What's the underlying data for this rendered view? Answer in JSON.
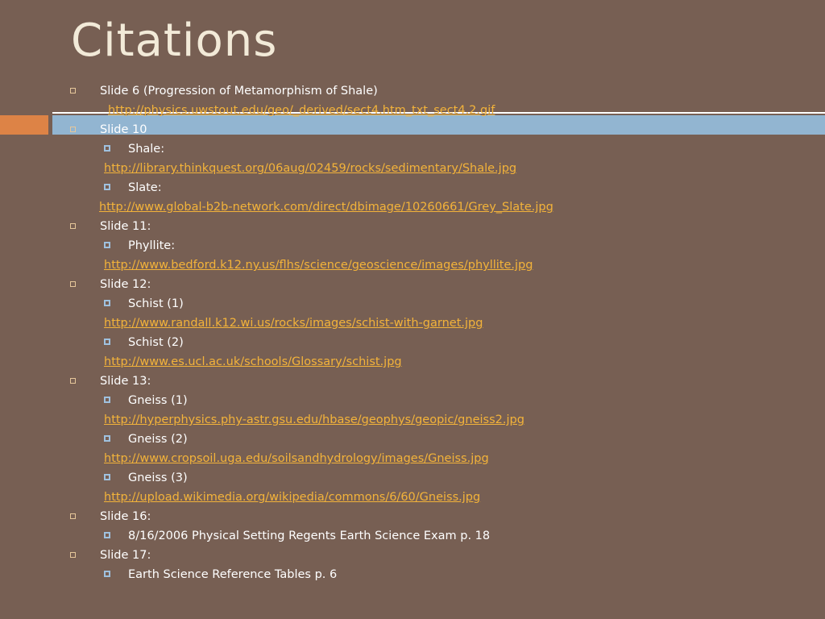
{
  "slide": {
    "title": "Citations",
    "colors": {
      "background": "#775f53",
      "title": "#f2ead8",
      "link": "#f3b33a",
      "accent_orange": "#dd8346",
      "accent_blue": "#92b5d1"
    },
    "items": [
      {
        "level": 1,
        "text": "Slide 6 (Progression of Metamorphism of Shale)"
      },
      {
        "level": "link",
        "text": "http://physics.uwstout.edu/geo/_derived/sect4.htm_txt_sect4.2.gif"
      },
      {
        "level": 1,
        "text": "Slide 10"
      },
      {
        "level": 2,
        "text": "Shale:"
      },
      {
        "level": "link",
        "text": "http://library.thinkquest.org/06aug/02459/rocks/sedimentary/Shale.jpg"
      },
      {
        "level": 2,
        "text": "Slate:"
      },
      {
        "level": "link",
        "text": "http://www.global-b2b-network.com/direct/dbimage/10260661/Grey_Slate.jpg"
      },
      {
        "level": 1,
        "text": "Slide 11:"
      },
      {
        "level": 2,
        "text": "Phyllite:"
      },
      {
        "level": "link",
        "text": "http://www.bedford.k12.ny.us/flhs/science/geoscience/images/phyllite.jpg"
      },
      {
        "level": 1,
        "text": "Slide 12:"
      },
      {
        "level": 2,
        "text": "Schist (1)"
      },
      {
        "level": "link",
        "text": "http://www.randall.k12.wi.us/rocks/images/schist-with-garnet.jpg"
      },
      {
        "level": 2,
        "text": "Schist (2)"
      },
      {
        "level": "link",
        "text": "http://www.es.ucl.ac.uk/schools/Glossary/schist.jpg"
      },
      {
        "level": 1,
        "text": "Slide 13:"
      },
      {
        "level": 2,
        "text": "Gneiss (1)"
      },
      {
        "level": "link",
        "text": "http://hyperphysics.phy-astr.gsu.edu/hbase/geophys/geopic/gneiss2.jpg"
      },
      {
        "level": 2,
        "text": "Gneiss (2)"
      },
      {
        "level": "link",
        "text": "http://www.cropsoil.uga.edu/soilsandhydrology/images/Gneiss.jpg"
      },
      {
        "level": 2,
        "text": "Gneiss (3)"
      },
      {
        "level": "link",
        "text": "http://upload.wikimedia.org/wikipedia/commons/6/60/Gneiss.jpg"
      },
      {
        "level": 1,
        "text": "Slide 16:"
      },
      {
        "level": 2,
        "text": "8/16/2006 Physical Setting Regents Earth Science Exam p. 18"
      },
      {
        "level": 1,
        "text": "Slide 17:"
      },
      {
        "level": 2,
        "text": "Earth Science Reference Tables p. 6"
      }
    ]
  }
}
